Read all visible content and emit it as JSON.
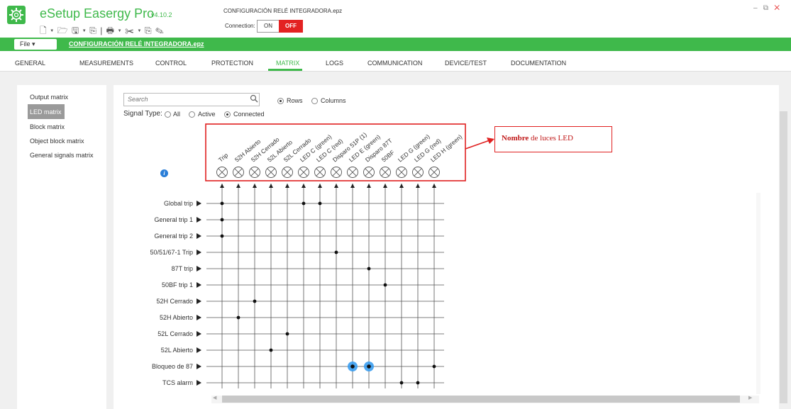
{
  "app": {
    "title": "eSetup Easergy Pro",
    "version": "v4.10.2",
    "document_title": "CONFIGURACIÓN RELÉ INTEGRADORA.epz",
    "toolbar_icons": "🗋 ▾ 🗁 🖫 ▾ ⎘ | 🖶 ▾ ✂ ▾ ⎘ ✎"
  },
  "connection": {
    "label": "Connection:",
    "on_label": "ON",
    "off_label": "OFF"
  },
  "window_controls": {
    "minimize": "–",
    "restore": "⧉",
    "close": "✕"
  },
  "filebar": {
    "file_label": "File  ▾",
    "file_name": "CONFIGURACIÓN RELÉ INTEGRADORA.epz"
  },
  "tabs": [
    {
      "label": "GENERAL"
    },
    {
      "label": "MEASUREMENTS"
    },
    {
      "label": "CONTROL"
    },
    {
      "label": "PROTECTION"
    },
    {
      "label": "MATRIX"
    },
    {
      "label": "LOGS"
    },
    {
      "label": "COMMUNICATION"
    },
    {
      "label": "DEVICE/TEST"
    },
    {
      "label": "DOCUMENTATION"
    }
  ],
  "active_tab": "MATRIX",
  "sidebar": {
    "items": [
      {
        "label": "Output matrix"
      },
      {
        "label": "LED matrix"
      },
      {
        "label": "Block matrix"
      },
      {
        "label": "Object block matrix"
      },
      {
        "label": "General signals matrix"
      }
    ],
    "selected": "LED matrix"
  },
  "search": {
    "placeholder": "Search"
  },
  "view_mode": {
    "rows_label": "Rows",
    "columns_label": "Columns",
    "selected": "Rows"
  },
  "signal_type": {
    "label": "Signal Type:",
    "all": "All",
    "active": "Active",
    "connected": "Connected",
    "selected": "Connected"
  },
  "matrix": {
    "columns": [
      "Trip",
      "52H Abierto",
      "52H Cerrado",
      "52L Abierto",
      "52L Cerrado",
      "LED C (green)",
      "LED C (red)",
      "Disparo 51P (1)",
      "LED E (green)",
      "Disparo 87T",
      "50BF",
      "LED G (green)",
      "LED G (red)",
      "LED H (green)"
    ],
    "rows": [
      "Global trip",
      "General trip 1",
      "General trip 2",
      "50/51/67-1 Trip",
      "87T trip",
      "50BF trip 1",
      "52H Cerrado",
      "52H Abierto",
      "52L Cerrado",
      "52L Abierto",
      "Bloqueo de 87",
      "TCS alarm"
    ],
    "connections": [
      [
        0,
        0
      ],
      [
        0,
        5
      ],
      [
        0,
        6
      ],
      [
        1,
        0
      ],
      [
        2,
        0
      ],
      [
        3,
        7
      ],
      [
        4,
        9
      ],
      [
        5,
        10
      ],
      [
        6,
        2
      ],
      [
        7,
        1
      ],
      [
        8,
        4
      ],
      [
        9,
        3
      ],
      [
        10,
        8
      ],
      [
        10,
        9
      ],
      [
        10,
        13
      ],
      [
        11,
        11
      ],
      [
        11,
        12
      ]
    ],
    "highlighted": [
      [
        10,
        8
      ],
      [
        10,
        9
      ]
    ]
  },
  "annotation": {
    "bold": "Nombre",
    "rest": " de luces LED"
  },
  "colors": {
    "brand": "#3fb94b",
    "off": "#e32222",
    "annotation": "#e02020",
    "highlight": "#3a9df0"
  }
}
